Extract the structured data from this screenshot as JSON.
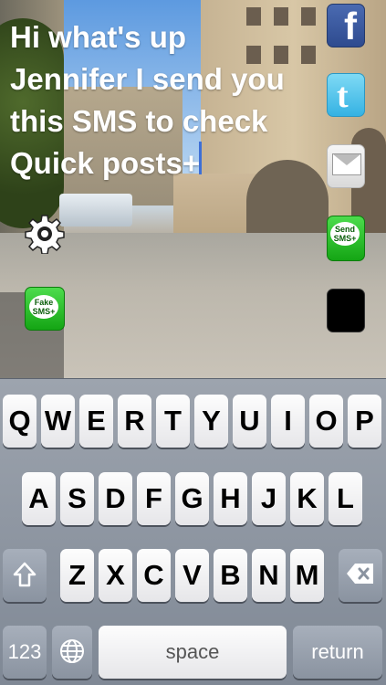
{
  "message": {
    "lines": [
      "Hi what's up",
      "Jennifer I send you",
      "this SMS to check",
      "Quick posts+"
    ]
  },
  "side_buttons": {
    "facebook_glyph": "f",
    "twitter_glyph": "t",
    "send_sms_text": [
      "Send",
      "SMS+"
    ],
    "fake_sms_text": [
      "Fake",
      "SMS+"
    ]
  },
  "keyboard": {
    "row1": [
      "Q",
      "W",
      "E",
      "R",
      "T",
      "Y",
      "U",
      "I",
      "O",
      "P"
    ],
    "row2": [
      "A",
      "S",
      "D",
      "F",
      "G",
      "H",
      "J",
      "K",
      "L"
    ],
    "row3": [
      "Z",
      "X",
      "C",
      "V",
      "B",
      "N",
      "M"
    ],
    "numbers_label": "123",
    "space_label": "space",
    "return_label": "return"
  },
  "colors": {
    "caret": "#3e6fd6",
    "sms_green": "#14a514",
    "facebook_blue": "#3b5998",
    "twitter_blue": "#35b2e3"
  }
}
